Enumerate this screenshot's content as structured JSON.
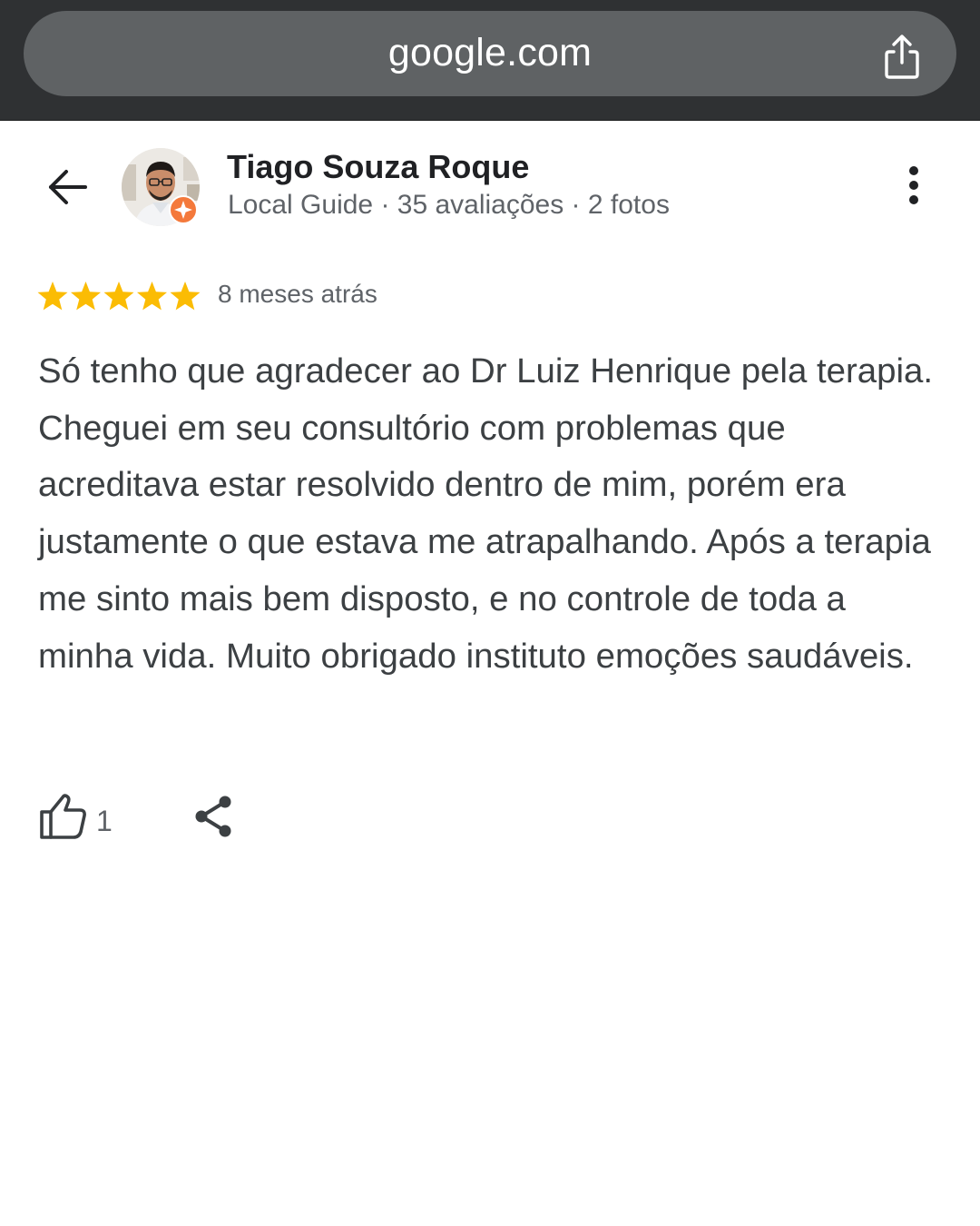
{
  "browser": {
    "url": "google.com",
    "share_icon": "share-upload-icon"
  },
  "reviewer": {
    "name": "Tiago Souza Roque",
    "meta": "Local Guide · 35 avaliações · 2 fotos",
    "badge_icon": "local-guide-badge-icon"
  },
  "review": {
    "rating": 5,
    "max_rating": 5,
    "date": "8 meses atrás",
    "text": "Só tenho que agradecer ao Dr Luiz Henrique pela terapia. Cheguei em seu consultório com problemas que acreditava estar resolvido dentro de mim, porém era justamente o que estava me atrapalhando. Após a terapia me sinto mais bem disposto, e no controle de toda a minha vida. Muito obrigado instituto emoções saudáveis.",
    "likes": "1"
  },
  "colors": {
    "star": "#fbbc04",
    "badge": "#f4793b",
    "text_primary": "#202124",
    "text_secondary": "#5f6368",
    "browser_bar": "#2f3133",
    "url_pill": "#5f6264"
  },
  "icons": {
    "back": "arrow-back-icon",
    "more": "more-vert-icon",
    "like": "thumb-up-icon",
    "share": "share-icon"
  }
}
